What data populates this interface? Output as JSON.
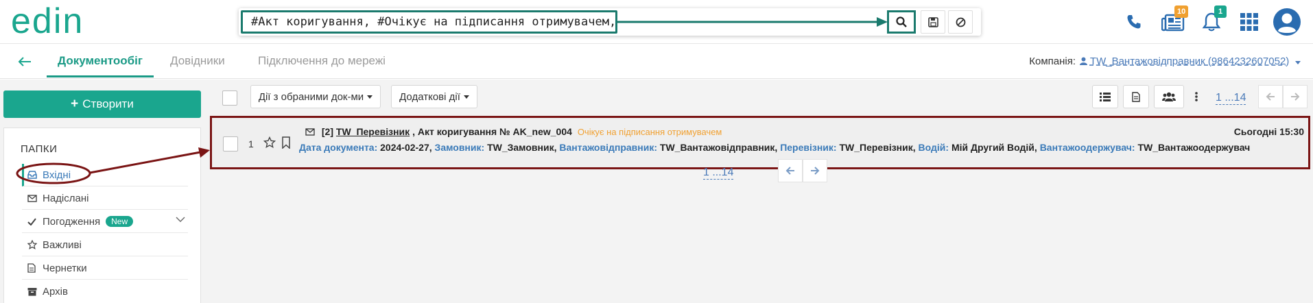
{
  "app": {
    "logo_text": "edin"
  },
  "search": {
    "query": "#Акт коригування, #Очікує на підписання отримувачем,",
    "search_icon": "magnifier-icon",
    "save_icon": "floppy-disk-icon",
    "reset_icon": "cancel-icon"
  },
  "header_icons": {
    "phone_icon": "phone-icon",
    "news_icon": "newspaper-icon",
    "news_count": "10",
    "bell_icon": "bell-icon",
    "bell_count": "1",
    "apps_icon": "grid-icon",
    "user_icon": "user-avatar-icon"
  },
  "nav": {
    "back_icon": "arrow-left-icon",
    "tabs": [
      {
        "label": "Документообіг"
      },
      {
        "label": "Довідники"
      },
      {
        "label": "Підключення до мережі"
      }
    ],
    "company_label": "Компанія:",
    "company_name": "TW_Вантажовідправник (9864232607052)"
  },
  "sidebar": {
    "create_label": "Створити",
    "folders_title": "ПАПКИ",
    "items": [
      {
        "label": "Вхідні",
        "icon": "inbox-icon"
      },
      {
        "label": "Надіслані",
        "icon": "envelope-icon"
      },
      {
        "label": "Погодження",
        "icon": "check-icon",
        "badge": "New"
      },
      {
        "label": "Важливі",
        "icon": "star-icon"
      },
      {
        "label": "Чернетки",
        "icon": "file-icon"
      },
      {
        "label": "Архів",
        "icon": "archive-icon"
      }
    ]
  },
  "toolbar": {
    "selected_actions_label": "Дії з обраними док-ми",
    "extra_actions_label": "Додаткові дії",
    "pager": "1 ...14"
  },
  "document": {
    "index": "1",
    "count_prefix": "[2]",
    "sender": "TW_Перевізник",
    "title": ", Акт коригування № AK_new_004",
    "status": "Очікує на підписання отримувачем",
    "received": "Сьогодні 15:30",
    "fields": [
      {
        "key": "Дата документа:",
        "value": "2024-02-27,"
      },
      {
        "key": "Замовник:",
        "value": "TW_Замовник,"
      },
      {
        "key": "Вантажовідправник:",
        "value": "TW_Вантажовідправник,"
      },
      {
        "key": "Перевізник:",
        "value": "TW_Перевізник,"
      },
      {
        "key": "Водій:",
        "value": "Мій Другий Водій,"
      },
      {
        "key": "Вантажоодержувач:",
        "value": "TW_Вантажоодержувач"
      }
    ]
  },
  "bottom_pager": "1 ...14",
  "colors": {
    "brand": "#1aa68e",
    "annotation_green": "#1a7a6d",
    "annotation_red": "#7a1414",
    "link": "#4a7ab8",
    "status_orange": "#f0a030"
  }
}
